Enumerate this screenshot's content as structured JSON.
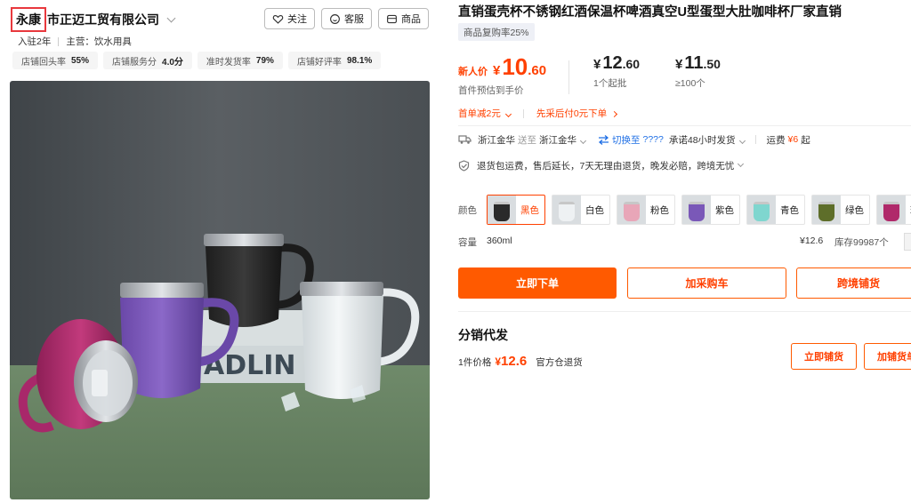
{
  "shop": {
    "name_highlight": "永康",
    "name_rest": "市正迈工贸有限公司",
    "follow_label": "关注",
    "service_label": "客服",
    "goods_label": "商品",
    "years": "入驻2年",
    "main_business": "主营：饮水用具",
    "stats": [
      {
        "label": "店铺回头率",
        "value": "55%"
      },
      {
        "label": "店铺服务分",
        "value": "4.0分"
      },
      {
        "label": "准时发货率",
        "value": "79%"
      },
      {
        "label": "店铺好评率",
        "value": "98.1%"
      }
    ]
  },
  "product": {
    "title": "直销蛋壳杯不锈钢红酒保温杯啤酒真空U型蛋型大肚咖啡杯厂家直销",
    "repurchase": "商品复购率25%",
    "image_text": "ADLIN"
  },
  "prices": {
    "new_label": "新人价",
    "main": {
      "yen": "¥",
      "int": "10",
      "dec": ".60",
      "sub": "首件预估到手价"
    },
    "tier1": {
      "yen": "¥",
      "int": "12",
      "dec": ".60",
      "sub": "1个起批"
    },
    "tier2": {
      "yen": "¥",
      "int": "11",
      "dec": ".50",
      "sub": "≥100个"
    }
  },
  "promos": {
    "discount": "首单减2元",
    "pay_later": "先采后付0元下单"
  },
  "shipping": {
    "from": "浙江金华",
    "to_label": "送至",
    "to": "浙江金华",
    "switch_label": "切换至",
    "switch_value": "????",
    "promise": "承诺48小时发货",
    "fee_label": "运费",
    "fee_value": "¥6",
    "fee_suffix": "起"
  },
  "services": "退货包运费，售后延长，7天无理由退货，晚发必赔，跨境无忧",
  "colors": {
    "label": "颜色",
    "options": [
      {
        "name": "黑色",
        "selected": true,
        "color": "#2a2a2a"
      },
      {
        "name": "白色",
        "selected": false,
        "color": "#eef1f3"
      },
      {
        "name": "粉色",
        "selected": false,
        "color": "#e8a6b8"
      },
      {
        "name": "紫色",
        "selected": false,
        "color": "#7a58b8"
      },
      {
        "name": "青色",
        "selected": false,
        "color": "#7fd6cf"
      },
      {
        "name": "绿色",
        "selected": false,
        "color": "#5e6e2a"
      },
      {
        "name": "玫红",
        "selected": false,
        "color": "#b0296a"
      }
    ]
  },
  "capacity": {
    "label": "容量",
    "value": "360ml",
    "price": "¥12.6",
    "stock": "库存99987个"
  },
  "actions": {
    "buy_now": "立即下单",
    "add_cart": "加采购车",
    "cross_border": "跨境铺货"
  },
  "distribution": {
    "title": "分销代发",
    "price_label": "1件价格",
    "price_yen": "¥",
    "price_value": "12.6",
    "return_note": "官方仓退货",
    "btn_list": "立即铺货",
    "btn_add": "加铺货单"
  },
  "accent_color": "#ff4000"
}
